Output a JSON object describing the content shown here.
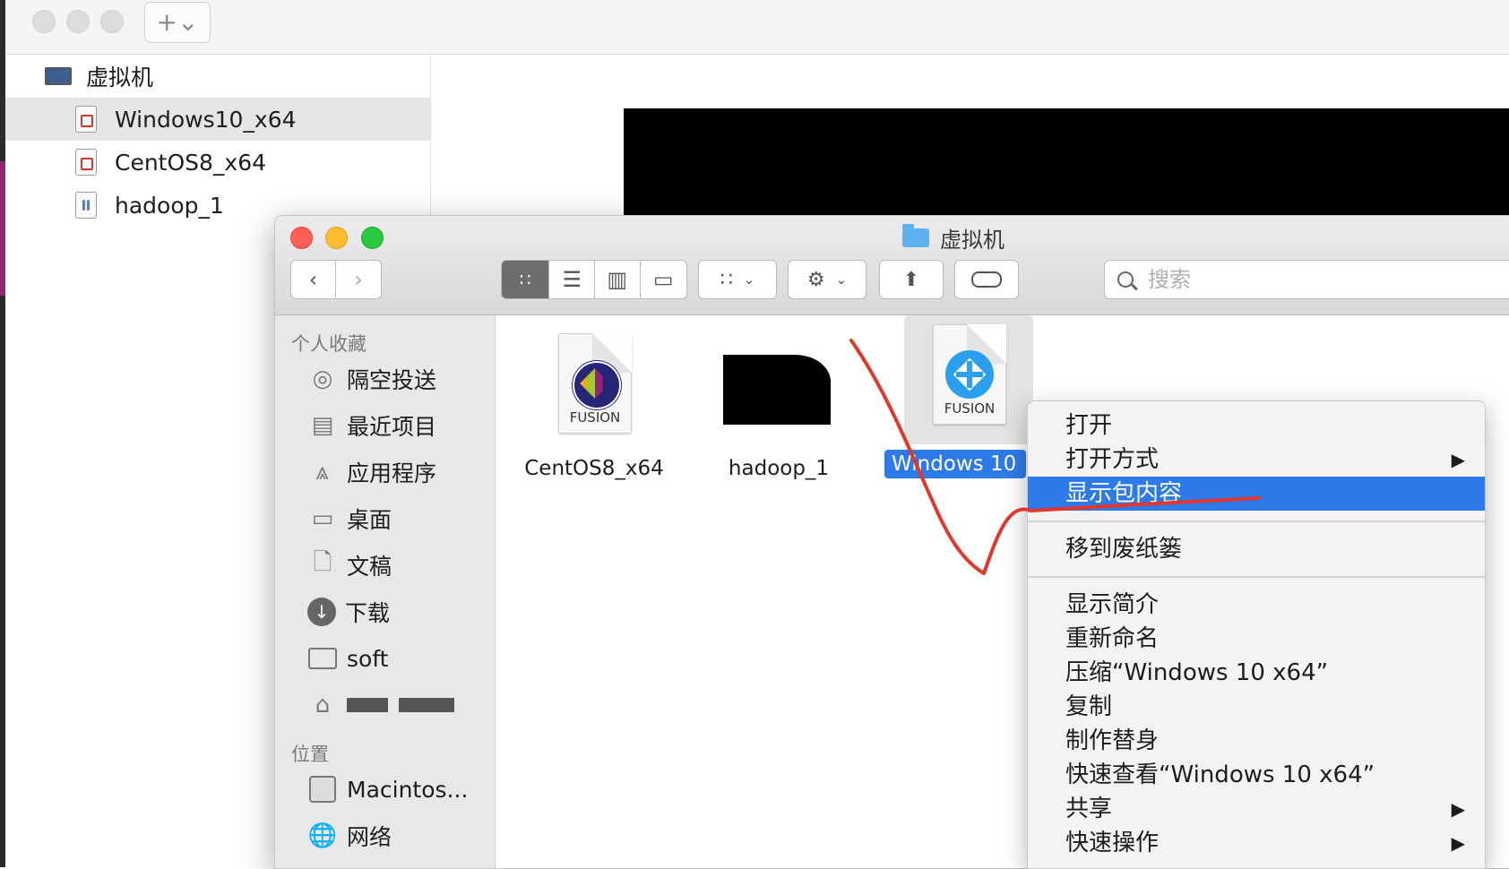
{
  "library": {
    "section_title": "虚拟机",
    "items": [
      {
        "label": "Windows10_x64",
        "selected": true
      },
      {
        "label": "CentOS8_x64",
        "selected": false
      },
      {
        "label": "hadoop_1",
        "selected": false
      }
    ],
    "add_glyph": "+⌄"
  },
  "finder": {
    "title": "虚拟机",
    "search_placeholder": "搜索",
    "sidebar": {
      "favorites_header": "个人收藏",
      "favorites": [
        {
          "label": "隔空投送",
          "icon": "airdrop-icon"
        },
        {
          "label": "最近项目",
          "icon": "recents-icon"
        },
        {
          "label": "应用程序",
          "icon": "applications-icon"
        },
        {
          "label": "桌面",
          "icon": "desktop-icon"
        },
        {
          "label": "文稿",
          "icon": "documents-icon"
        },
        {
          "label": "下载",
          "icon": "downloads-icon"
        },
        {
          "label": "soft",
          "icon": "folder-icon"
        },
        {
          "label": "",
          "icon": "home-icon"
        }
      ],
      "locations_header": "位置",
      "locations": [
        {
          "label": "Macintos...",
          "icon": "disk-icon"
        },
        {
          "label": "网络",
          "icon": "network-icon"
        }
      ]
    },
    "files": [
      {
        "name": "CentOS8_x64",
        "badge": "FUSION",
        "icon": "centos-vm-icon"
      },
      {
        "name": "hadoop_1",
        "badge": "",
        "icon": "hadoop-vm-icon"
      },
      {
        "name": "Windows 10",
        "badge": "FUSION",
        "icon": "windows-vm-icon",
        "selected": true
      }
    ]
  },
  "context_menu": {
    "items": [
      {
        "label": "打开",
        "submenu": false
      },
      {
        "label": "打开方式",
        "submenu": true
      },
      {
        "label": "显示包内容",
        "submenu": false,
        "highlighted": true
      },
      {
        "label": "移到废纸篓",
        "submenu": false
      },
      {
        "label": "显示简介",
        "submenu": false
      },
      {
        "label": "重新命名",
        "submenu": false
      },
      {
        "label": "压缩“Windows 10 x64”",
        "submenu": false
      },
      {
        "label": "复制",
        "submenu": false
      },
      {
        "label": "制作替身",
        "submenu": false
      },
      {
        "label": "快速查看“Windows 10 x64”",
        "submenu": false
      },
      {
        "label": "共享",
        "submenu": true
      },
      {
        "label": "快速操作",
        "submenu": true
      }
    ],
    "submenu_glyph": "▶"
  },
  "colors": {
    "highlight": "#2d7bea",
    "close": "#fe5f57",
    "minimize": "#febc2e",
    "zoom": "#28c840",
    "annotation": "#e2372a"
  }
}
